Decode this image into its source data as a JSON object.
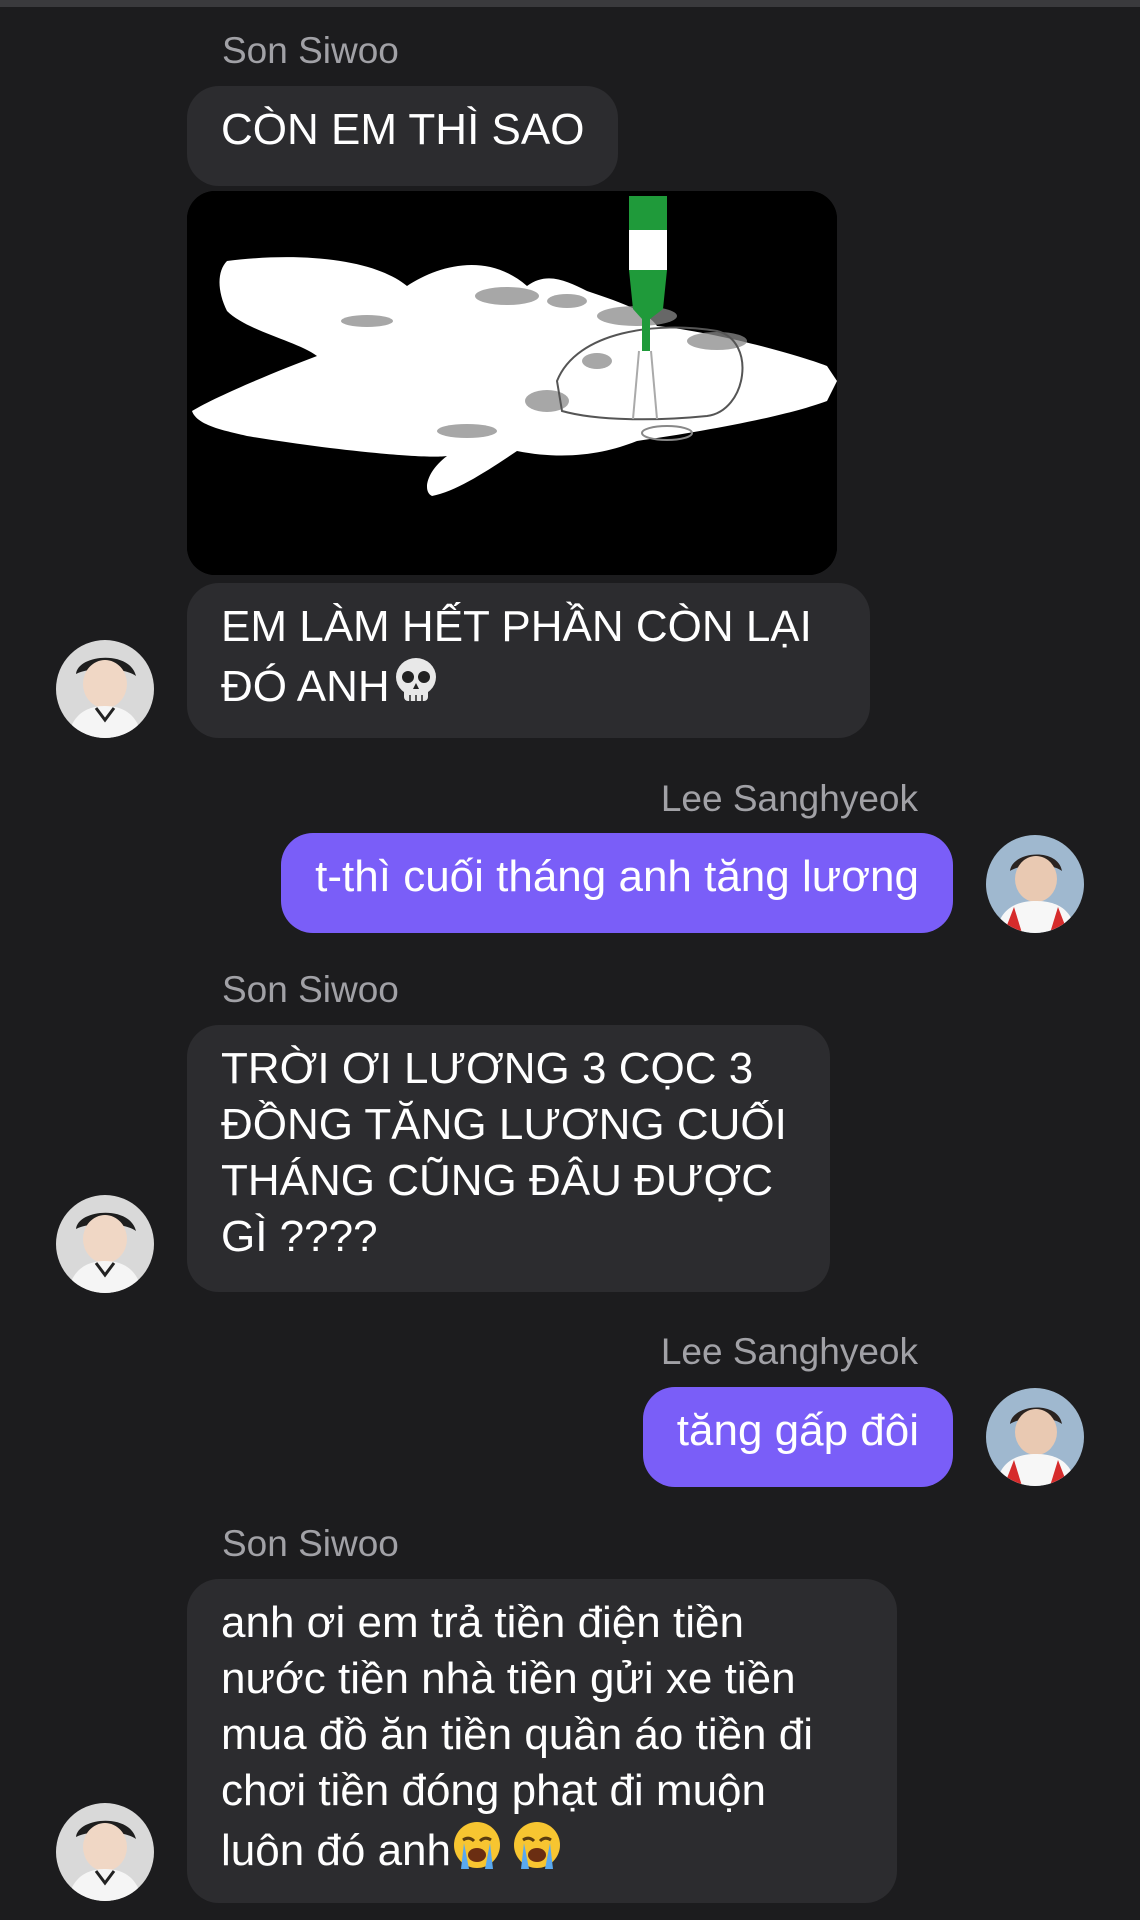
{
  "contacts": {
    "friend_name": "Son Siwoo",
    "me_name": "Lee Sanghyeok"
  },
  "messages": [
    {
      "id": "m1",
      "from": "Son Siwoo",
      "text": "CÒN EM THÌ SAO"
    },
    {
      "id": "m2",
      "from": "Son Siwoo",
      "type": "image",
      "image_icon": "drawing-image"
    },
    {
      "id": "m3",
      "from": "Son Siwoo",
      "text": "EM LÀM HẾT PHẦN CÒN LẠI\nĐÓ ANH",
      "emoji": "skull-emoji"
    },
    {
      "id": "m4",
      "from": "Lee Sanghyeok",
      "text": "t-thì cuối tháng anh tăng lương"
    },
    {
      "id": "m5",
      "from": "Son Siwoo",
      "text": "TRỜI ƠI LƯƠNG 3 CỌC 3\nĐỒNG TĂNG LƯƠNG CUỐI\nTHÁNG CŨNG ĐÂU ĐƯỢC\nGÌ ????"
    },
    {
      "id": "m6",
      "from": "Lee Sanghyeok",
      "text": "tăng gấp đôi"
    },
    {
      "id": "m7",
      "from": "Son Siwoo",
      "text": "anh ơi em trả tiền điện tiền\nnước tiền nhà tiền gửi xe tiền\nmua đồ ăn tiền quần áo tiền đi\nchơi tiền đóng phạt đi muộn\nluôn đó anh",
      "emoji": "loudly-crying-emoji x2"
    }
  ],
  "colors": {
    "background": "#1c1c1e",
    "incoming_bubble": "#2c2c2f",
    "outgoing_bubble": "#7a5ef8",
    "sender_name": "#a1a1a6"
  }
}
